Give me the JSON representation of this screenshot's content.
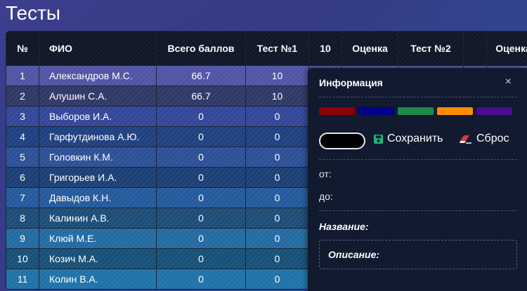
{
  "page": {
    "title": "Тесты"
  },
  "table": {
    "headers": [
      "№",
      "ФИО",
      "Всего баллов",
      "Тест №1",
      "10",
      "Оценка",
      "Тест №2",
      "",
      "Оценка"
    ],
    "rows": [
      {
        "num": "1",
        "name": "Александров  М.С.",
        "total": "66.7",
        "test1": "10",
        "color": "#4f54a4"
      },
      {
        "num": "2",
        "name": "Алушин  С.А.",
        "total": "66.7",
        "test1": "10",
        "color": "#2f3866"
      },
      {
        "num": "3",
        "name": "Выборов  И.А.",
        "total": "0",
        "test1": "0",
        "color": "#34469a"
      },
      {
        "num": "4",
        "name": "Гарфутдинова  А.Ю.",
        "total": "0",
        "test1": "0",
        "color": "#1f4080"
      },
      {
        "num": "5",
        "name": "Головкин  К.М.",
        "total": "0",
        "test1": "0",
        "color": "#2b5096"
      },
      {
        "num": "6",
        "name": "Григорьев  И.А.",
        "total": "0",
        "test1": "0",
        "color": "#1b3f75"
      },
      {
        "num": "7",
        "name": "Давыдов  К.Н.",
        "total": "0",
        "test1": "0",
        "color": "#245a9c"
      },
      {
        "num": "8",
        "name": "Калинин  А.В.",
        "total": "0",
        "test1": "0",
        "color": "#1c4d78"
      },
      {
        "num": "9",
        "name": "Клюй  М.Е.",
        "total": "0",
        "test1": "0",
        "color": "#236aa2"
      },
      {
        "num": "10",
        "name": "Козич  М.А.",
        "total": "0",
        "test1": "0",
        "color": "#175077"
      },
      {
        "num": "11",
        "name": "Колин  В.А.",
        "total": "0",
        "test1": "0",
        "color": "#1f72a8"
      }
    ]
  },
  "panel": {
    "title": "Информация",
    "close": "×",
    "swatches": [
      "#8b0000",
      "#00008b",
      "#1e8a4a",
      "#ff8c00",
      "#4b0c8f"
    ],
    "selected_color": "#000000",
    "save_label": "Сохранить",
    "reset_label": "Сброс",
    "from_label": "от:",
    "to_label": "до:",
    "name_label": "Название:",
    "description_label": "Описание:"
  }
}
